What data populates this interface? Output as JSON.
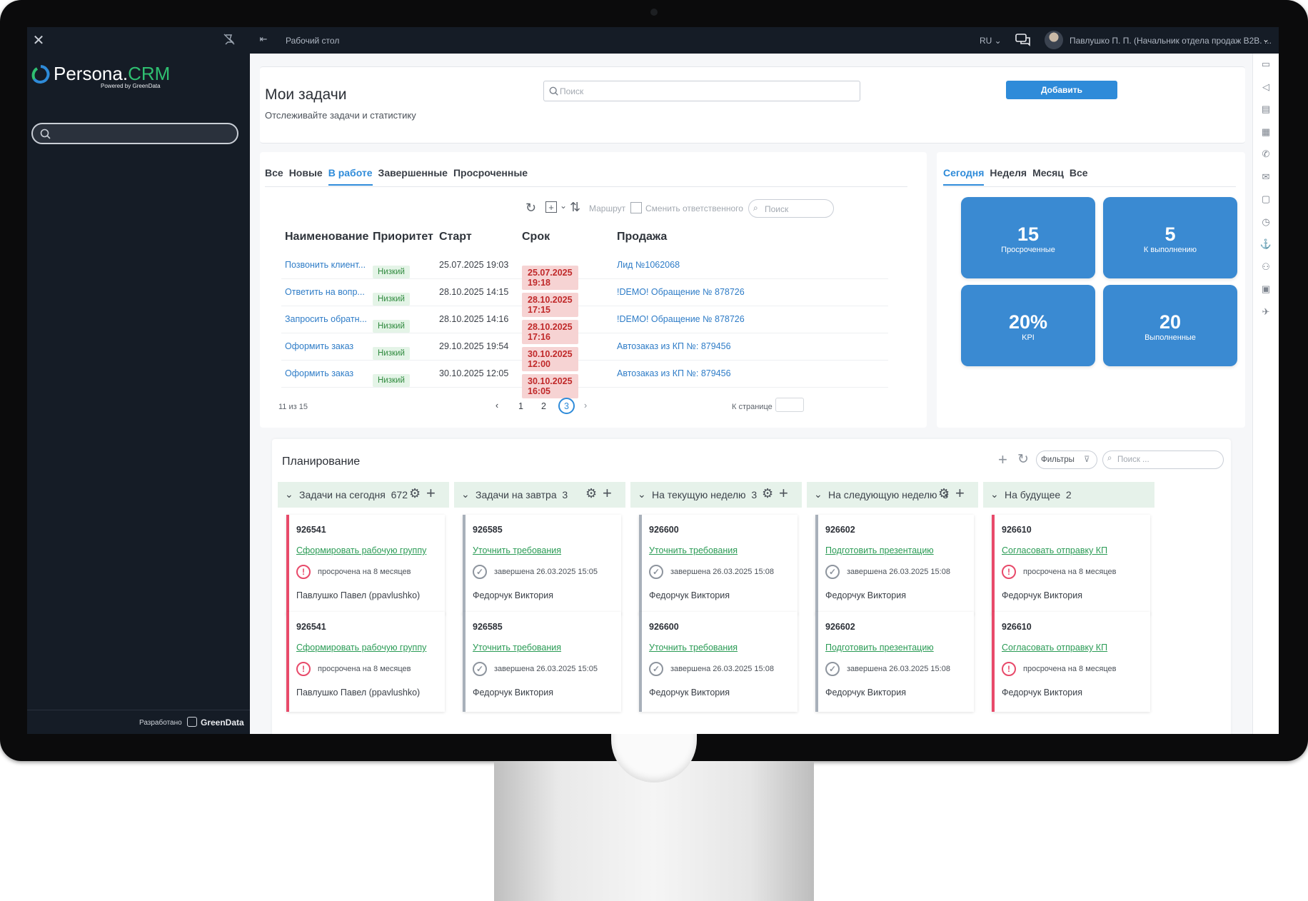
{
  "topbar": {
    "breadcrumb": "Рабочий стол",
    "lang": "RU",
    "user": "Павлушко П. П. (Начальник отдела продаж B2B. ..."
  },
  "sidebar": {
    "brand_a": "Persona.",
    "brand_b": "CRM",
    "powered": "Powered by GreenData",
    "footer_label": "Разработано",
    "footer_brand": "GreenData"
  },
  "header": {
    "title": "Мои задачи",
    "subtitle": "Отслеживайте задачи и статистику",
    "search_placeholder": "Поиск",
    "add_label": "Добавить"
  },
  "tasks": {
    "tabs": [
      "Все",
      "Новые",
      "В работе",
      "Завершенные",
      "Просроченные"
    ],
    "active_tab": "В работе",
    "toolbar": {
      "route": "Маршрут",
      "change": "Сменить ответственного",
      "search_placeholder": "Поиск"
    },
    "columns": [
      "Наименование",
      "Приоритет",
      "Старт",
      "Срок",
      "Продажа"
    ],
    "rows": [
      {
        "name": "Позвонить клиент...",
        "priority": "Низкий",
        "start": "25.07.2025 19:03",
        "due": "25.07.2025 19:18",
        "sale": "Лид №1062068"
      },
      {
        "name": "Ответить на вопр...",
        "priority": "Низкий",
        "start": "28.10.2025 14:15",
        "due": "28.10.2025 17:15",
        "sale": "!DEMO! Обращение № 878726"
      },
      {
        "name": "Запросить обратн...",
        "priority": "Низкий",
        "start": "28.10.2025 14:16",
        "due": "28.10.2025 17:16",
        "sale": "!DEMO! Обращение № 878726"
      },
      {
        "name": "Оформить заказ",
        "priority": "Низкий",
        "start": "29.10.2025 19:54",
        "due": "30.10.2025 12:00",
        "sale": "Автозаказ из КП №: 879456"
      },
      {
        "name": "Оформить заказ",
        "priority": "Низкий",
        "start": "30.10.2025 12:05",
        "due": "30.10.2025 16:05",
        "sale": "Автозаказ из КП №: 879456"
      }
    ],
    "count": "11 из 15",
    "pages": [
      "1",
      "2",
      "3"
    ],
    "current_page": "3",
    "goto_label": "К странице"
  },
  "stats": {
    "tabs": [
      "Сегодня",
      "Неделя",
      "Месяц",
      "Все"
    ],
    "active_tab": "Сегодня",
    "tiles": [
      {
        "value": "15",
        "label": "Просроченные"
      },
      {
        "value": "5",
        "label": "К выполнению"
      },
      {
        "value": "20%",
        "label": "KPI"
      },
      {
        "value": "20",
        "label": "Выполненные"
      }
    ]
  },
  "planning": {
    "title": "Планирование",
    "filters_label": "Фильтры",
    "search_placeholder": "Поиск ...",
    "columns": [
      {
        "title": "Задачи на сегодня",
        "count": "672",
        "card": {
          "id": "926541",
          "title": "Сформировать рабочую группу",
          "status": "просрочена на 8 месяцев",
          "owner": "Павлушко Павел (ppavlushko)",
          "overdue": true
        }
      },
      {
        "title": "Задачи на завтра",
        "count": "3",
        "card": {
          "id": "926585",
          "title": "Уточнить требования",
          "status": "завершена 26.03.2025 15:05",
          "owner": "Федорчук Виктория",
          "overdue": false
        }
      },
      {
        "title": "На текущую неделю",
        "count": "3",
        "card": {
          "id": "926600",
          "title": "Уточнить требования",
          "status": "завершена 26.03.2025 15:08",
          "owner": "Федорчук Виктория",
          "overdue": false
        }
      },
      {
        "title": "На следующую неделю",
        "count": "3",
        "card": {
          "id": "926602",
          "title": "Подготовить презентацию",
          "status": "завершена 26.03.2025 15:08",
          "owner": "Федорчук Виктория",
          "overdue": false
        }
      },
      {
        "title": "На будущее",
        "count": "2",
        "card": {
          "id": "926610",
          "title": "Согласовать отправку КП",
          "status": "просрочена на 8 месяцев",
          "owner": "Федорчук Виктория",
          "overdue": true
        }
      }
    ]
  }
}
